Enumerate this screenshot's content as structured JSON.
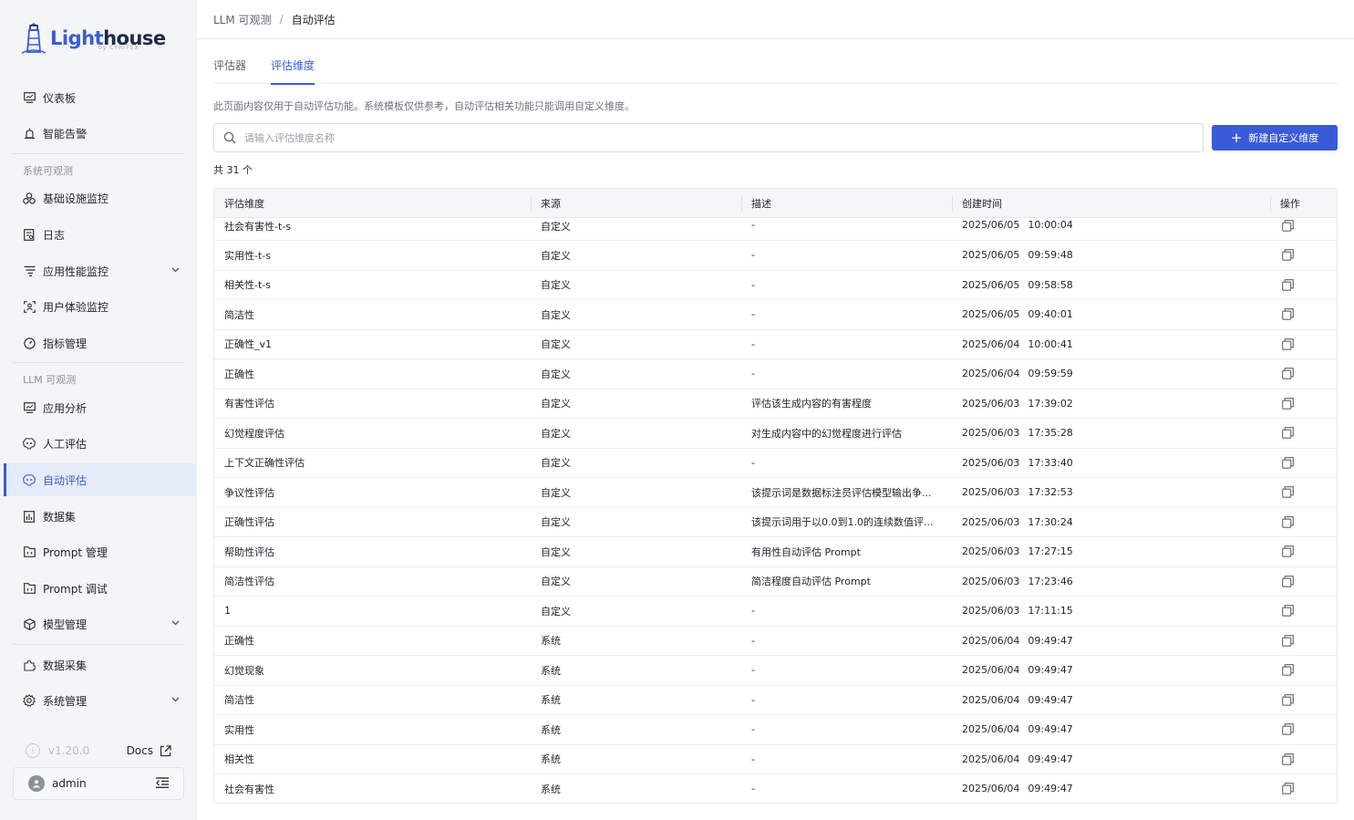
{
  "brand": {
    "part1": "Light",
    "part2": "house",
    "sub": "by CYRITEX"
  },
  "sidebar": {
    "top_items": [
      {
        "label": "仪表板",
        "icon": "monitor-icon"
      },
      {
        "label": "智能告警",
        "icon": "alarm-icon"
      }
    ],
    "section1": "系统可观测",
    "section1_items": [
      {
        "label": "基础设施监控",
        "icon": "cluster-icon"
      },
      {
        "label": "日志",
        "icon": "log-icon"
      },
      {
        "label": "应用性能监控",
        "icon": "filter-list-icon",
        "expandable": true
      },
      {
        "label": "用户体验监控",
        "icon": "user-scan-icon"
      },
      {
        "label": "指标管理",
        "icon": "gauge-icon"
      }
    ],
    "section2": "LLM 可观测",
    "section2_items": [
      {
        "label": "应用分析",
        "icon": "monitor-icon"
      },
      {
        "label": "人工评估",
        "icon": "brain-icon"
      },
      {
        "label": "自动评估",
        "icon": "brain-icon",
        "active": true
      },
      {
        "label": "数据集",
        "icon": "chart-box-icon"
      },
      {
        "label": "Prompt 管理",
        "icon": "folder-icon"
      },
      {
        "label": "Prompt 调试",
        "icon": "folder-icon"
      },
      {
        "label": "模型管理",
        "icon": "cube-icon",
        "expandable": true
      }
    ],
    "bottom_items": [
      {
        "label": "数据采集",
        "icon": "puzzle-icon"
      },
      {
        "label": "系统管理",
        "icon": "gear-icon",
        "expandable": true
      }
    ],
    "version": "v1.20.0",
    "docs_label": "Docs",
    "username": "admin"
  },
  "breadcrumb": {
    "parent": "LLM 可观测",
    "separator": "/",
    "current": "自动评估"
  },
  "tabs": [
    {
      "label": "评估器",
      "active": false
    },
    {
      "label": "评估维度",
      "active": true
    }
  ],
  "notice": "此页面内容仅用于自动评估功能。系统模板仅供参考，自动评估相关功能只能调用自定义维度。",
  "search": {
    "placeholder": "请输入评估维度名称",
    "value": ""
  },
  "add_button_label": "新建自定义维度",
  "count_label": "共 31 个",
  "accent_color": "#3a5bd9",
  "table": {
    "columns": [
      "评估维度",
      "来源",
      "描述",
      "创建时间",
      "操作"
    ],
    "rows": [
      {
        "name": "社会有害性-t-s",
        "source": "自定义",
        "desc": "-",
        "date": "2025/06/05",
        "time": "10:00:04"
      },
      {
        "name": "实用性-t-s",
        "source": "自定义",
        "desc": "-",
        "date": "2025/06/05",
        "time": "09:59:48"
      },
      {
        "name": "相关性-t-s",
        "source": "自定义",
        "desc": "-",
        "date": "2025/06/05",
        "time": "09:58:58"
      },
      {
        "name": "简洁性",
        "source": "自定义",
        "desc": "-",
        "date": "2025/06/05",
        "time": "09:40:01"
      },
      {
        "name": "正确性_v1",
        "source": "自定义",
        "desc": "-",
        "date": "2025/06/04",
        "time": "10:00:41"
      },
      {
        "name": "正确性",
        "source": "自定义",
        "desc": "-",
        "date": "2025/06/04",
        "time": "09:59:59"
      },
      {
        "name": "有害性评估",
        "source": "自定义",
        "desc": "评估该生成内容的有害程度",
        "date": "2025/06/03",
        "time": "17:39:02"
      },
      {
        "name": "幻觉程度评估",
        "source": "自定义",
        "desc": "对生成内容中的幻觉程度进行评估",
        "date": "2025/06/03",
        "time": "17:35:28"
      },
      {
        "name": "上下文正确性评估",
        "source": "自定义",
        "desc": "-",
        "date": "2025/06/03",
        "time": "17:33:40"
      },
      {
        "name": "争议性评估",
        "source": "自定义",
        "desc": "该提示词是数据标注员评估模型输出争...",
        "date": "2025/06/03",
        "time": "17:32:53"
      },
      {
        "name": "正确性评估",
        "source": "自定义",
        "desc": "该提示词用于以0.0到1.0的连续数值评...",
        "date": "2025/06/03",
        "time": "17:30:24"
      },
      {
        "name": "帮助性评估",
        "source": "自定义",
        "desc": "有用性自动评估 Prompt",
        "date": "2025/06/03",
        "time": "17:27:15"
      },
      {
        "name": "简洁性评估",
        "source": "自定义",
        "desc": "简洁程度自动评估 Prompt",
        "date": "2025/06/03",
        "time": "17:23:46"
      },
      {
        "name": "1",
        "source": "自定义",
        "desc": "-",
        "date": "2025/06/03",
        "time": "17:11:15"
      },
      {
        "name": "正确性",
        "source": "系统",
        "desc": "-",
        "date": "2025/06/04",
        "time": "09:49:47"
      },
      {
        "name": "幻觉现象",
        "source": "系统",
        "desc": "-",
        "date": "2025/06/04",
        "time": "09:49:47"
      },
      {
        "name": "简洁性",
        "source": "系统",
        "desc": "-",
        "date": "2025/06/04",
        "time": "09:49:47"
      },
      {
        "name": "实用性",
        "source": "系统",
        "desc": "-",
        "date": "2025/06/04",
        "time": "09:49:47"
      },
      {
        "name": "相关性",
        "source": "系统",
        "desc": "-",
        "date": "2025/06/04",
        "time": "09:49:47"
      },
      {
        "name": "社会有害性",
        "source": "系统",
        "desc": "-",
        "date": "2025/06/04",
        "time": "09:49:47"
      }
    ]
  }
}
